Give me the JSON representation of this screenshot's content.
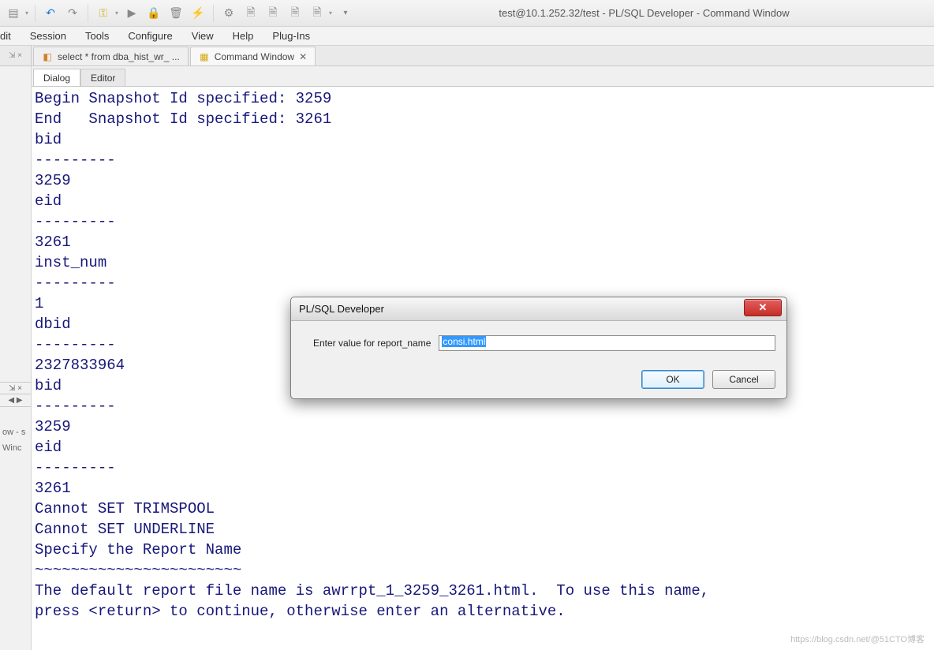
{
  "title": "test@10.1.252.32/test - PL/SQL Developer - Command Window",
  "menu": [
    "dit",
    "Session",
    "Tools",
    "Configure",
    "View",
    "Help",
    "Plug-Ins"
  ],
  "fileTabs": [
    {
      "label": "select * from dba_hist_wr_ ...",
      "icon": "sql-icon",
      "active": false
    },
    {
      "label": "Command Window",
      "icon": "cmd-icon",
      "active": true
    }
  ],
  "subTabs": [
    {
      "label": "Dialog",
      "active": true
    },
    {
      "label": "Editor",
      "active": false
    }
  ],
  "output": "Begin Snapshot Id specified: 3259\nEnd   Snapshot Id specified: 3261\nbid\n---------\n3259\neid\n---------\n3261\ninst_num\n---------\n1\ndbid\n---------\n2327833964\nbid\n---------\n3259\neid\n---------\n3261\nCannot SET TRIMSPOOL\nCannot SET UNDERLINE\nSpecify the Report Name\n~~~~~~~~~~~~~~~~~~~~~~~\nThe default report file name is awrrpt_1_3259_3261.html.  To use this name,\npress <return> to continue, otherwise enter an alternative.",
  "dialog": {
    "title": "PL/SQL Developer",
    "prompt": "Enter value for report_name",
    "input_value": "consi.html",
    "ok": "OK",
    "cancel": "Cancel"
  },
  "side": {
    "l1": "ow - s",
    "l2": "Winc",
    "topglyph": "⇲ ×",
    "midglyph": "⇲ ×",
    "arrows": "◀  ▶"
  },
  "watermark": "https://blog.csdn.net/@51CTO博客"
}
